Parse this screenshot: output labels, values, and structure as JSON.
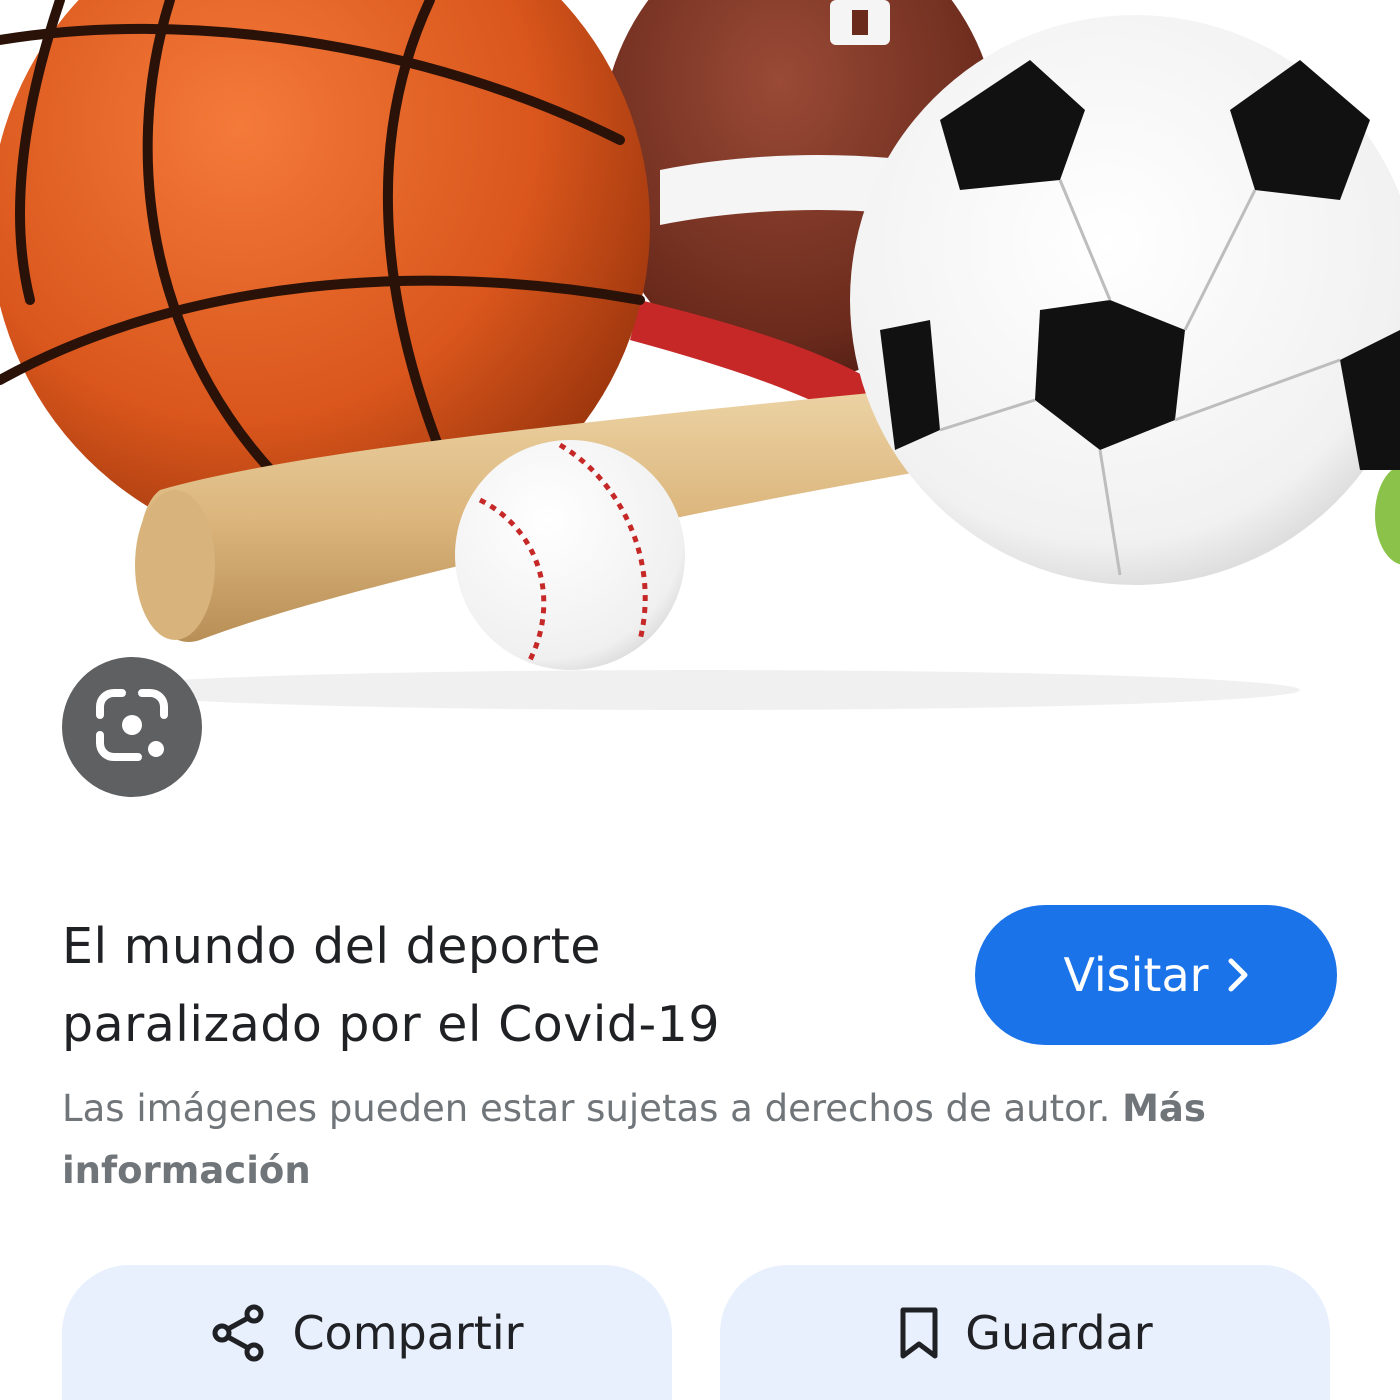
{
  "result": {
    "title_line1": "El mundo del deporte",
    "title_line2": "paralizado por el Covid-19",
    "visit_label": "Visitar"
  },
  "notice": {
    "text": "Las imágenes pueden estar sujetas a derechos de autor.",
    "more_label": "Más información"
  },
  "actions": {
    "share_label": "Compartir",
    "save_label": "Guardar"
  },
  "icons": {
    "lens": "google-lens-icon",
    "visit": "chevron-right-icon",
    "share": "share-icon",
    "save": "bookmark-icon"
  },
  "colors": {
    "accent": "#1a73e8",
    "pill_bg": "#e8f0fe",
    "lens_bg": "#5f6062",
    "text_primary": "#202124",
    "text_secondary": "#70757a"
  }
}
